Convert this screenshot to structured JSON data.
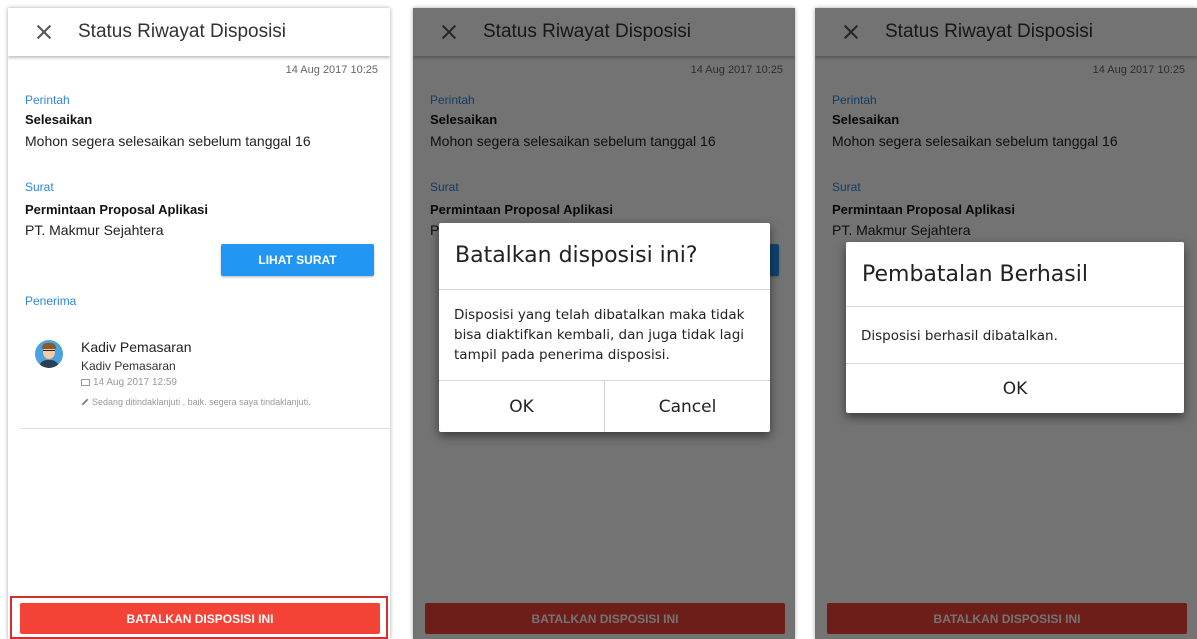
{
  "header": {
    "title": "Status Riwayat Disposisi"
  },
  "date": "14 Aug 2017 10:25",
  "perintah": {
    "label": "Perintah",
    "value": "Selesaikan",
    "message": "Mohon segera selesaikan sebelum tanggal 16"
  },
  "surat": {
    "label": "Surat",
    "title": "Permintaan Proposal Aplikasi",
    "company": "PT. Makmur Sejahtera",
    "button": "LIHAT SURAT"
  },
  "penerima": {
    "label": "Penerima",
    "name": "Kadiv Pemasaran",
    "role": "Kadiv Pemasaran",
    "time": "14 Aug 2017 12:59",
    "note": "Sedang ditindaklanjuti , baik. segera saya tindaklanjuti."
  },
  "bottom_button": "BATALKAN DISPOSISI INI",
  "confirm_dialog": {
    "title": "Batalkan disposisi ini?",
    "message": "Disposisi yang telah dibatalkan maka tidak bisa diaktifkan kembali, dan juga tidak lagi tampil pada penerima disposisi.",
    "ok": "OK",
    "cancel": "Cancel"
  },
  "success_dialog": {
    "title": "Pembatalan Berhasil",
    "message": "Disposisi berhasil dibatalkan.",
    "ok": "OK"
  },
  "colors": {
    "accent_blue": "#2196f3",
    "danger_red": "#f44336",
    "label_blue": "#2e86de"
  },
  "icons": {
    "close": "close-icon",
    "mail": "mail-icon",
    "pencil": "pencil-icon",
    "avatar": "avatar"
  }
}
